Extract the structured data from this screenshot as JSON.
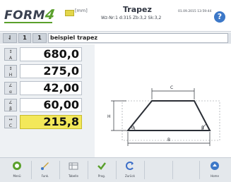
{
  "header": {
    "logo_text": "FORM",
    "logo_four": "4",
    "unit": "[mm]",
    "title": "Trapez",
    "subtitle": "Wz-Nr:1 d:315 Zb:3,2 Sk:3,2",
    "datetime": "01.09.2015 13:59:44",
    "help_label": "?"
  },
  "toolbar": {
    "arrow_label": "⇃",
    "index": "1",
    "mark": "1",
    "name": "beispiel trapez"
  },
  "params": [
    {
      "icon_text": "A",
      "value": "680,0"
    },
    {
      "icon_text": "H",
      "value": "275,0"
    },
    {
      "icon_text": "α",
      "value": "42,00"
    },
    {
      "icon_text": "β",
      "value": "60,00"
    },
    {
      "icon_text": "C",
      "value": "215,8"
    }
  ],
  "drawing": {
    "labels": {
      "C": "C",
      "H": "H",
      "B": "B",
      "alpha": "α",
      "beta": "β"
    }
  },
  "bottom_buttons": [
    {
      "label": "Menü",
      "icon": "home-icon",
      "color": "#5aa02c"
    },
    {
      "label": "Funk.",
      "icon": "tool-icon",
      "color": "#c9a23a"
    },
    {
      "label": "Tabelle",
      "icon": "table-icon",
      "color": "#8a9099"
    },
    {
      "label": "Prog.",
      "icon": "check-icon",
      "color": "#5aa02c"
    },
    {
      "label": "Zurück",
      "icon": "back-icon",
      "color": "#3c6ec8"
    },
    {
      "label": "Home",
      "icon": "hand-icon",
      "color": "#3c78c8"
    }
  ],
  "colors": {
    "accent": "#5aa02c",
    "active_value": "#f3e85a",
    "help": "#3c78c8"
  }
}
